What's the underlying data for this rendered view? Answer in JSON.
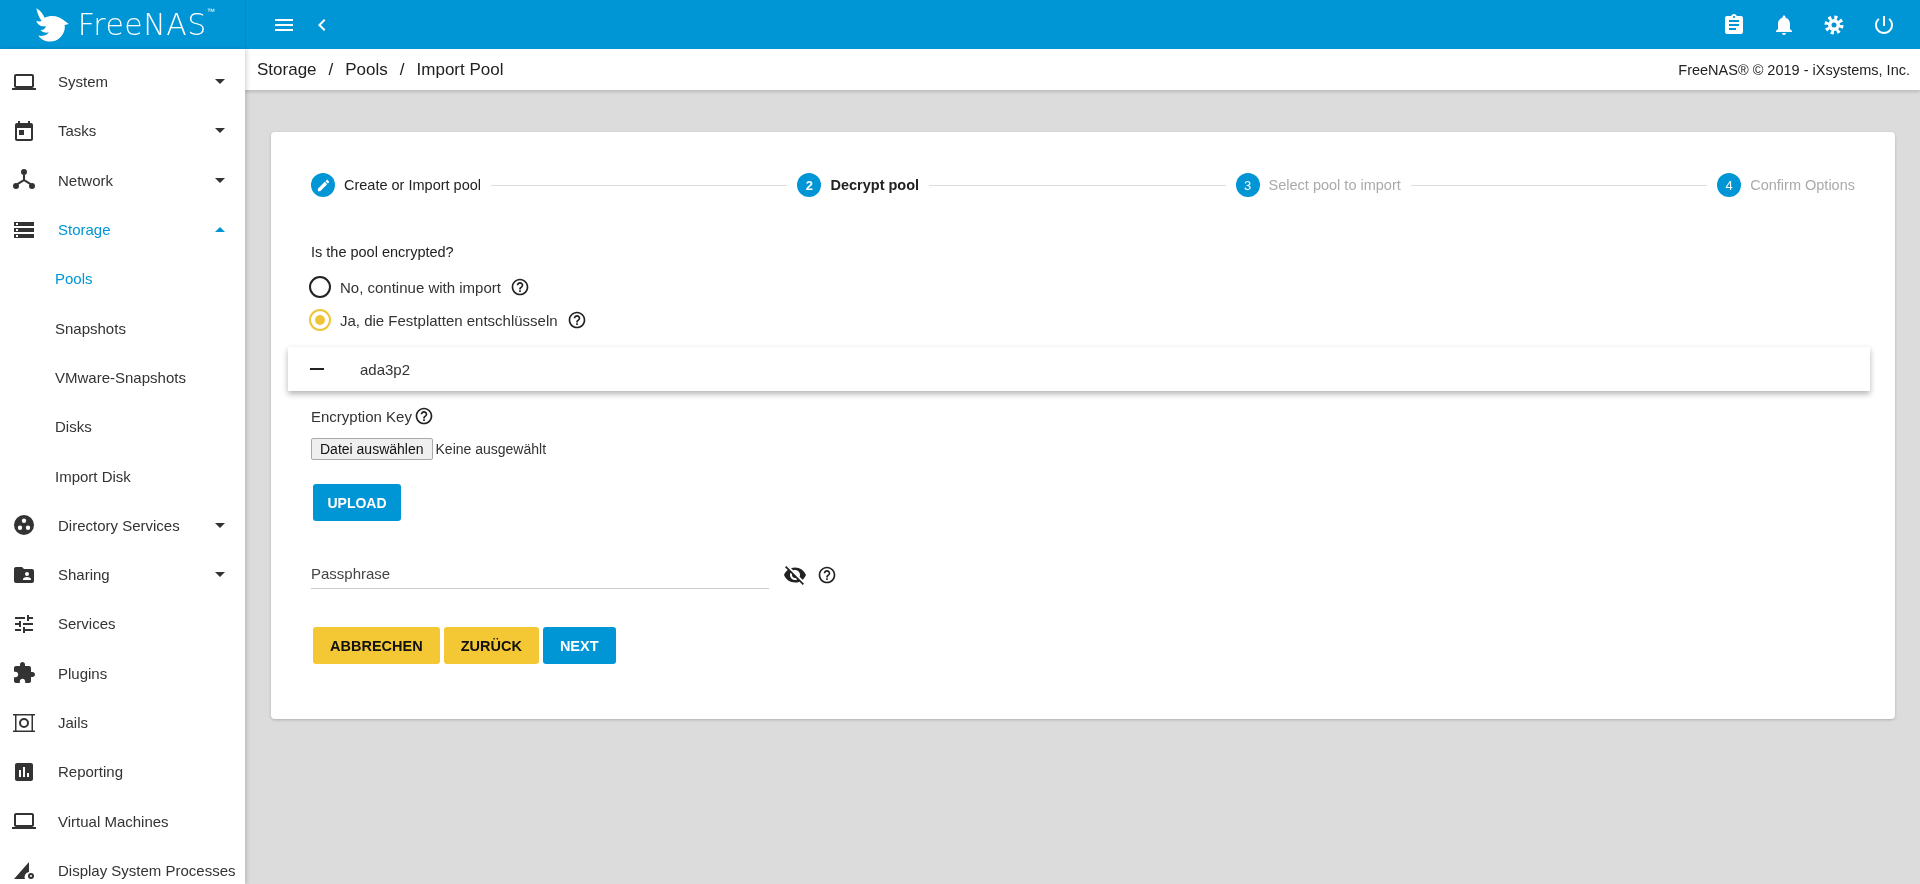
{
  "header": {
    "logo": "FreeNAS",
    "trademark": "™"
  },
  "breadcrumb": {
    "separator": "/",
    "items": [
      "Storage",
      "Pools",
      "Import Pool"
    ]
  },
  "copyright": "FreeNAS® © 2019 - iXsystems, Inc.",
  "sidebar": {
    "items": [
      {
        "label": "System",
        "kind": "group",
        "expanded": false,
        "selected": false
      },
      {
        "label": "Tasks",
        "kind": "group",
        "expanded": false,
        "selected": false
      },
      {
        "label": "Network",
        "kind": "group",
        "expanded": false,
        "selected": false
      },
      {
        "label": "Storage",
        "kind": "group",
        "expanded": true,
        "selected": true,
        "children": [
          {
            "label": "Pools",
            "selected": true
          },
          {
            "label": "Snapshots",
            "selected": false
          },
          {
            "label": "VMware-Snapshots",
            "selected": false
          },
          {
            "label": "Disks",
            "selected": false
          },
          {
            "label": "Import Disk",
            "selected": false
          }
        ]
      },
      {
        "label": "Directory Services",
        "kind": "group",
        "expanded": false,
        "selected": false
      },
      {
        "label": "Sharing",
        "kind": "group",
        "expanded": false,
        "selected": false
      },
      {
        "label": "Services",
        "kind": "link",
        "selected": false
      },
      {
        "label": "Plugins",
        "kind": "link",
        "selected": false
      },
      {
        "label": "Jails",
        "kind": "link",
        "selected": false
      },
      {
        "label": "Reporting",
        "kind": "link",
        "selected": false
      },
      {
        "label": "Virtual Machines",
        "kind": "link",
        "selected": false
      },
      {
        "label": "Display System Processes",
        "kind": "link",
        "selected": false
      }
    ]
  },
  "stepper": [
    {
      "label": "Create or Import pool",
      "completed": true,
      "selected": false
    },
    {
      "number": "2",
      "label": "Decrypt pool",
      "completed": false,
      "selected": true
    },
    {
      "number": "3",
      "label": "Select pool to import",
      "completed": false,
      "selected": false
    },
    {
      "number": "4",
      "label": "Confirm Options",
      "completed": false,
      "selected": false
    }
  ],
  "form": {
    "question": "Is the pool encrypted?",
    "options": [
      {
        "label": "No, continue with import",
        "selected": false
      },
      {
        "label": "Ja, die Festplatten entschlüsseln",
        "selected": true
      }
    ],
    "disks_menu": [
      {
        "label": "ada3p2",
        "indeterminate": true
      }
    ],
    "encryption_key": {
      "label": "Encryption Key",
      "choose_button": "Datei auswählen",
      "file_status": "Keine ausgewählt",
      "upload_button": "UPLOAD"
    },
    "passphrase": {
      "placeholder": "Passphrase"
    },
    "buttons": [
      {
        "label": "ABBRECHEN",
        "kind": "secondary"
      },
      {
        "label": "ZURÜCK",
        "kind": "secondary"
      },
      {
        "label": "NEXT",
        "kind": "primary"
      }
    ]
  }
}
